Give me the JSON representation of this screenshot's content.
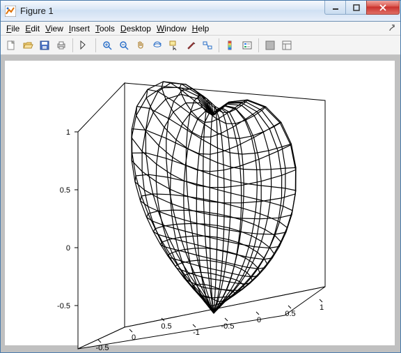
{
  "window": {
    "title": "Figure 1"
  },
  "menu": {
    "file": "File",
    "edit": "Edit",
    "view": "View",
    "insert": "Insert",
    "tools": "Tools",
    "desktop": "Desktop",
    "window": "Window",
    "help": "Help"
  },
  "chart_data": {
    "type": "surface",
    "description": "3D wireframe isosurface (heart-shaped implicit surface) rendered in MATLAB axes",
    "xlabel": "",
    "ylabel": "",
    "zlabel": "",
    "x_ticks": [
      -0.5,
      0,
      0.5
    ],
    "y_ticks": [
      -1,
      -0.5,
      0,
      0.5,
      1
    ],
    "z_ticks": [
      -0.5,
      0,
      0.5,
      1
    ],
    "x_range": [
      -0.7,
      0.7
    ],
    "y_range": [
      -1.2,
      1.2
    ],
    "z_range": [
      -0.9,
      1.2
    ],
    "view": "3d-default",
    "grid": false,
    "box": true,
    "facecolor": "none",
    "edgecolor": "#000000"
  },
  "ticks": {
    "z0": "-0.5",
    "z1": "0",
    "z2": "0.5",
    "z3": "1",
    "x0": "-0.5",
    "x1": "0",
    "x2": "0.5",
    "y0": "-1",
    "y1": "-0.5",
    "y2": "0",
    "y3": "0.5",
    "y4": "1"
  }
}
